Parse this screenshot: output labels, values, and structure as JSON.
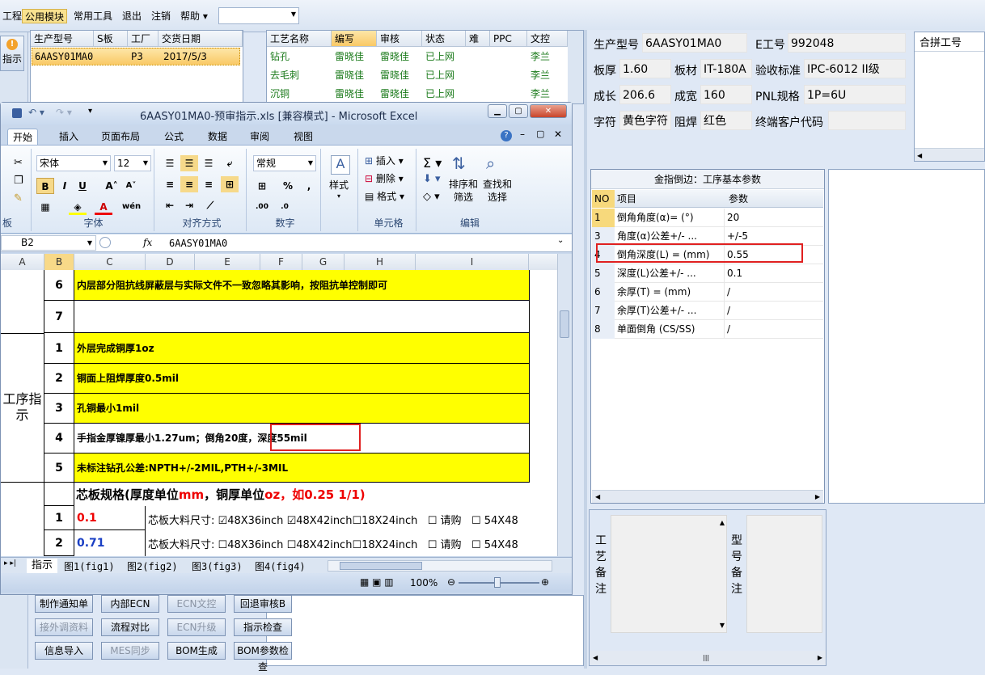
{
  "menu": {
    "items": [
      "工程",
      "公用模块",
      "常用工具",
      "退出",
      "注销",
      "帮助"
    ],
    "active": "公用模块"
  },
  "left_button": "指示",
  "order_table": {
    "headers": [
      "生产型号",
      "S板",
      "工厂",
      "交货日期"
    ],
    "row": [
      "6AASY01MA0",
      "",
      "P3",
      "2017/5/3"
    ]
  },
  "process_table": {
    "headers": [
      "工艺名称",
      "编写",
      "审核",
      "状态",
      "难",
      "PPC",
      "文控"
    ],
    "rows": [
      [
        "钻孔",
        "雷晓佳",
        "雷晓佳",
        "已上网",
        "",
        "",
        "李兰"
      ],
      [
        "去毛刺",
        "雷晓佳",
        "雷晓佳",
        "已上网",
        "",
        "",
        "李兰"
      ],
      [
        "沉铜",
        "雷晓佳",
        "雷晓佳",
        "已上网",
        "",
        "",
        "李兰"
      ]
    ]
  },
  "excel": {
    "title": "6AASY01MA0-预审指示.xls [兼容模式] - Microsoft Excel",
    "tabs": [
      "开始",
      "插入",
      "页面布局",
      "公式",
      "数据",
      "审阅",
      "视图"
    ],
    "active_tab": "开始",
    "font_name": "宋体",
    "font_size": "12",
    "number_format": "常规",
    "group_labels": [
      "板",
      "字体",
      "对齐方式",
      "数字",
      "样式",
      "单元格",
      "编辑"
    ],
    "style_label": "样式",
    "cells_btns": [
      "插入",
      "删除",
      "格式"
    ],
    "edit_btns": [
      "排序和筛选",
      "查找和选择"
    ],
    "name_box": "B2",
    "fx": "fx",
    "formula": "6AASY01MA0",
    "columns": [
      "A",
      "B",
      "C",
      "D",
      "E",
      "F",
      "G",
      "H",
      "I"
    ],
    "rows": [
      {
        "num": "6",
        "text": "内层部分阻抗线屏蔽层与实际文件不一致忽略其影响，按阻抗单控制即可",
        "yellow": true
      },
      {
        "num": "7",
        "text": "",
        "yellow": false
      },
      {
        "num": "1",
        "text": "外层完成铜厚1oz",
        "yellow": true
      },
      {
        "num": "2",
        "text": "铜面上阻焊厚度0.5mil",
        "yellow": true
      },
      {
        "num": "3",
        "text": "孔铜最小1mil",
        "yellow": true
      },
      {
        "num": "4",
        "text": "手指金厚镍厚最小1.27um；倒角20度，深度55mil",
        "yellow": false
      },
      {
        "num": "5",
        "text": "未标注钻孔公差:NPTH+/-2MIL,PTH+/-3MIL",
        "yellow": true
      }
    ],
    "section_label": "工序指示",
    "core_header": {
      "prefix": "芯板规格(厚度单位",
      "mm": "mm",
      "mid": "，铜厚单位",
      "oz": "oz",
      "suffix": "，如0.25 1/1)"
    },
    "core_rows": [
      {
        "num": "1",
        "val": "0.1",
        "label": "芯板大料尺寸:",
        "opts": [
          "48X36inch",
          "48X42inch",
          "18X24inch",
          "请购",
          "54X48"
        ],
        "checked": [
          true,
          true,
          false,
          false,
          false
        ]
      },
      {
        "num": "2",
        "val": "0.71",
        "label": "芯板大料尺寸:",
        "opts": [
          "48X36inch",
          "48X42inch",
          "18X24inch",
          "请购",
          "54X48"
        ],
        "checked": [
          false,
          false,
          false,
          false,
          false
        ]
      }
    ],
    "sheets": [
      "指示",
      "图1(fig1)",
      "图2(fig2)",
      "图3(fig3)",
      "图4(fig4)"
    ],
    "zoom": "100%"
  },
  "bottom_buttons": [
    [
      "制作通知单",
      "内部ECN",
      "ECN文控",
      "回退审核B"
    ],
    [
      "接外调资料",
      "流程对比",
      "ECN升级",
      "指示检查"
    ],
    [
      "信息导入",
      "MES同步",
      "BOM生成",
      "BOM参数检查"
    ]
  ],
  "info": {
    "prod_model_label": "生产型号",
    "prod_model": "6AASY01MA0",
    "e_no_label": "E工号",
    "e_no": "992048",
    "thick_label": "板厚",
    "thick": "1.60",
    "material_label": "板材",
    "material": "IT-180A",
    "std_label": "验收标准",
    "std": "IPC-6012 II级",
    "len_label": "成长",
    "len": "206.6",
    "width_label": "成宽",
    "width": "160",
    "pnl_label": "PNL规格",
    "pnl": "1P=6U",
    "char_label": "字符",
    "char": "黄色字符",
    "mask_label": "阻焊",
    "mask": "红色",
    "cust_label": "终端客户代码",
    "cust": ""
  },
  "merge_label": "合拼工号",
  "params": {
    "title": "金指倒边：工序基本参数",
    "headers": [
      "NO",
      "项目",
      "参数"
    ],
    "rows": [
      [
        "1",
        "倒角角度(α)=  (°)",
        "20"
      ],
      [
        "3",
        "角度(α)公差+/- ...",
        "+/-5"
      ],
      [
        "4",
        "倒角深度(L) =  (mm)",
        "0.55"
      ],
      [
        "5",
        "深度(L)公差+/- ...",
        "0.1"
      ],
      [
        "6",
        "余厚(T) =  (mm)",
        "/"
      ],
      [
        "7",
        "余厚(T)公差+/-  ...",
        "/"
      ],
      [
        "8",
        "单面倒角 (CS/SS)",
        "/"
      ]
    ]
  },
  "notes": {
    "craft_label": "工艺备注",
    "model_label": "型号备注"
  }
}
